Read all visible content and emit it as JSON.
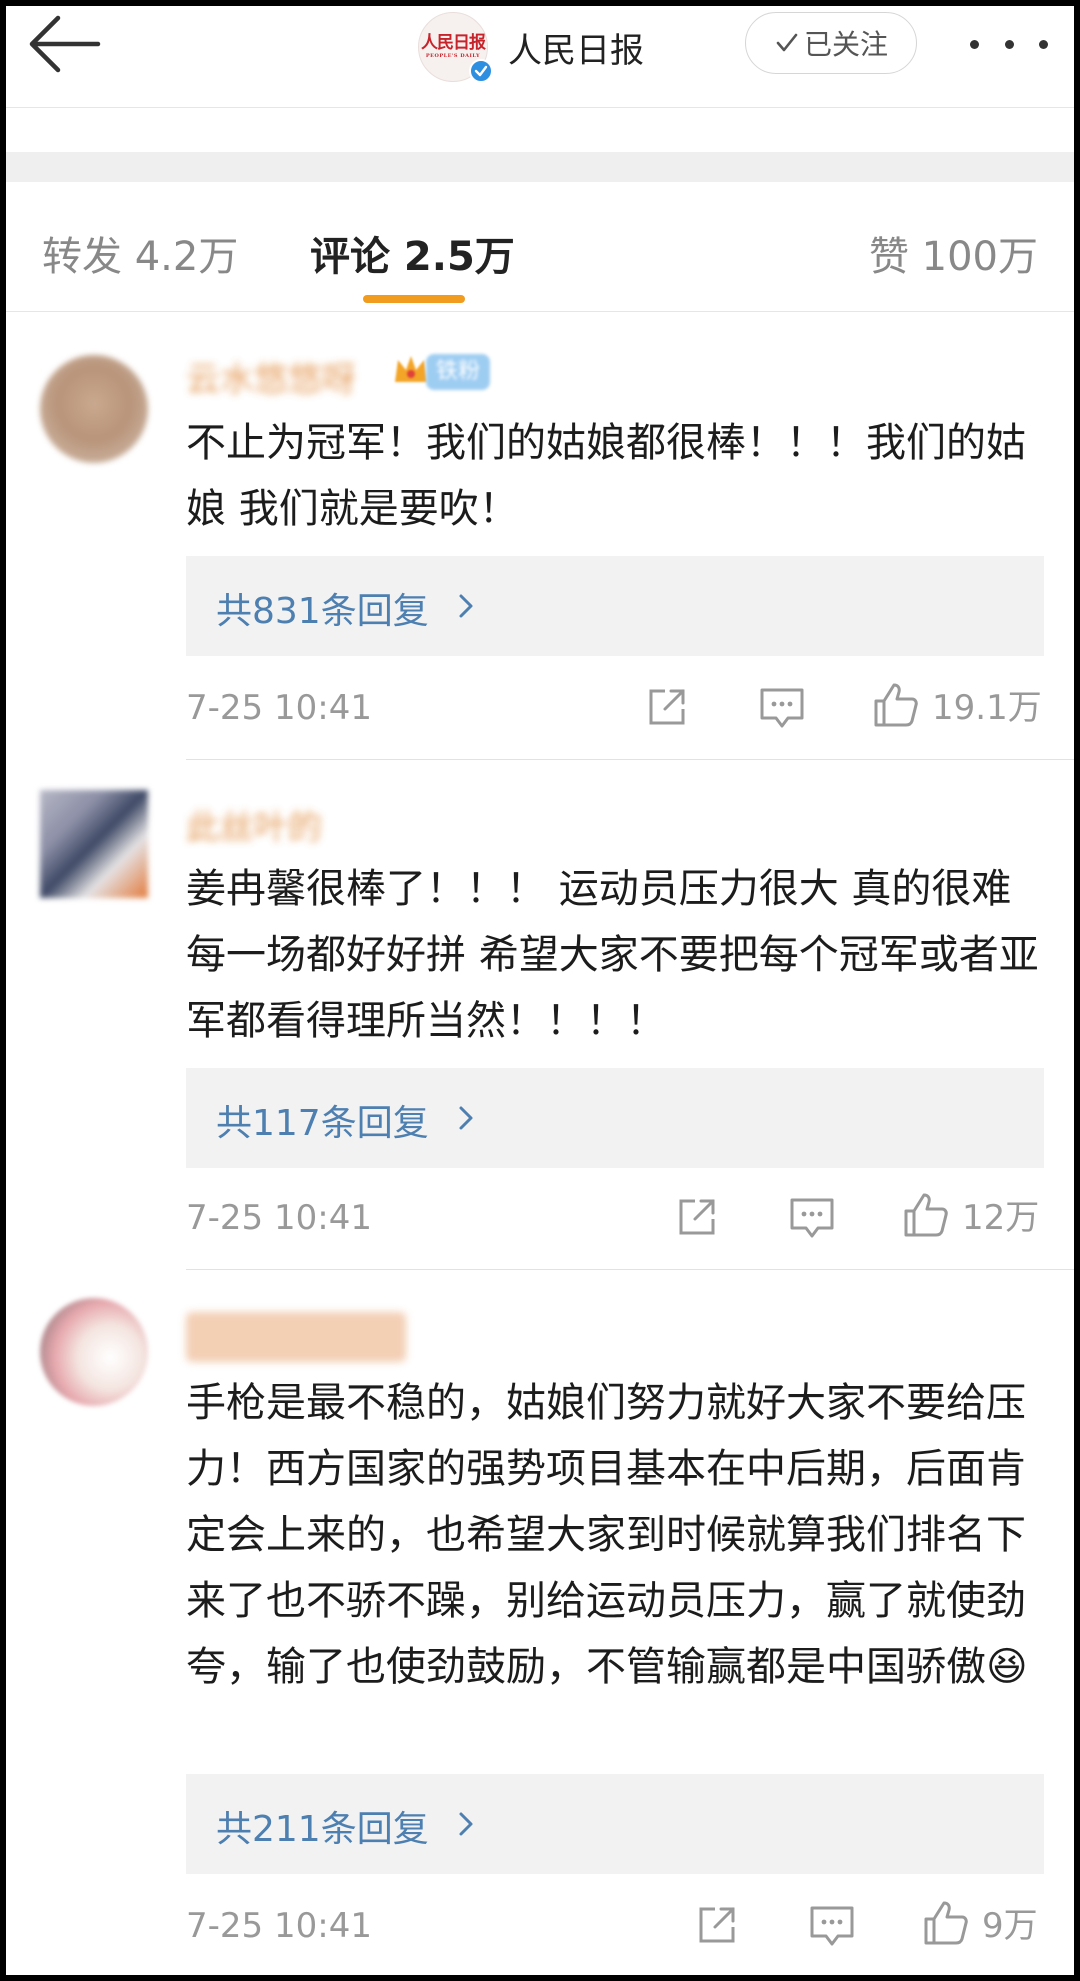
{
  "header": {
    "account_name": "人民日报",
    "logo_text": "人民日报",
    "logo_sub": "PEOPLE'S DAILY",
    "follow_label": "已关注",
    "back_icon": "arrow-left-icon",
    "more_icon": "more-dots-icon"
  },
  "tabs": {
    "repost": "转发 4.2万",
    "comment": "评论 2.5万",
    "like": "赞 100万",
    "active": "comment",
    "accent_color": "#f29c1f"
  },
  "comments": [
    {
      "username": "云水悠悠呀",
      "badge": "铁粉",
      "text": "不止为冠军！我们的姑娘都很棒！！！我们的姑娘 我们就是要吹！",
      "replies": "共831条回复",
      "time": "7-25 10:41",
      "likes": "19.1万"
    },
    {
      "username": "此丝叶的",
      "text": "姜冉馨很棒了！！！ 运动员压力很大 真的很难 每一场都好好拼 希望大家不要把每个冠军或者亚军都看得理所当然！！！！",
      "replies": "共117条回复",
      "time": "7-25 10:41",
      "likes": "12万"
    },
    {
      "username": "",
      "text": "手枪是最不稳的，姑娘们努力就好大家不要给压力！西方国家的强势项目基本在中后期，后面肯定会上来的，也希望大家到时候就算我们排名下来了也不骄不躁，别给运动员压力，赢了就使劲夸，输了也使劲鼓励，不管输赢都是中国骄傲😆",
      "replies": "共211条回复",
      "time": "7-25 10:41",
      "likes": "9万"
    }
  ]
}
